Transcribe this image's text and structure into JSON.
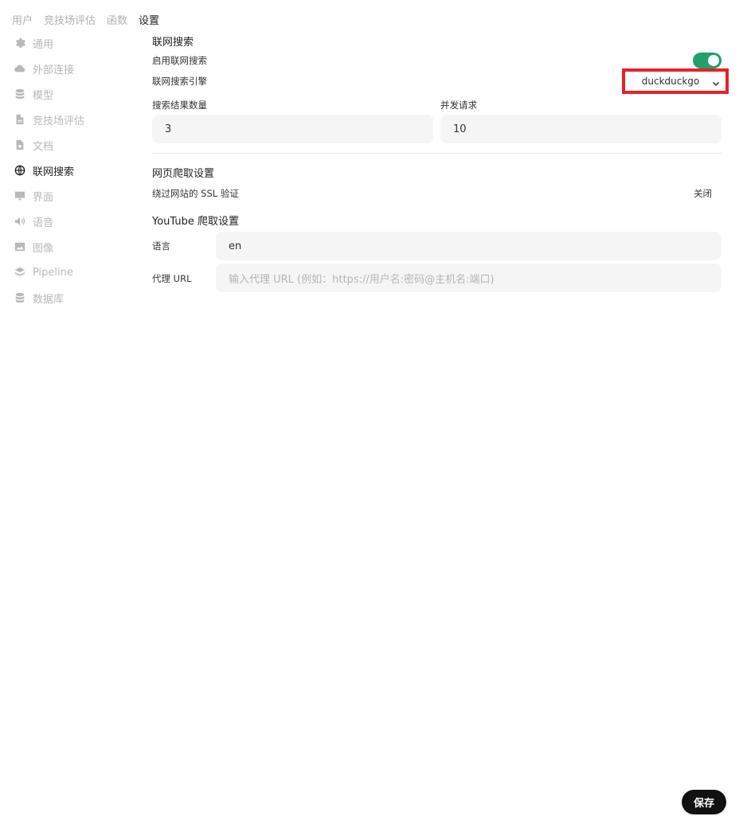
{
  "top_tabs": [
    {
      "label": "用户"
    },
    {
      "label": "竞技场评估"
    },
    {
      "label": "函数"
    },
    {
      "label": "设置"
    }
  ],
  "sidebar": {
    "items": [
      {
        "label": "通用",
        "icon": "gear-icon"
      },
      {
        "label": "外部连接",
        "icon": "cloud-icon"
      },
      {
        "label": "模型",
        "icon": "database-icon"
      },
      {
        "label": "竞技场评估",
        "icon": "document-icon"
      },
      {
        "label": "文档",
        "icon": "document-search-icon"
      },
      {
        "label": "联网搜索",
        "icon": "globe-icon"
      },
      {
        "label": "界面",
        "icon": "monitor-icon"
      },
      {
        "label": "语音",
        "icon": "speaker-icon"
      },
      {
        "label": "图像",
        "icon": "image-icon"
      },
      {
        "label": "Pipeline",
        "icon": "layers-icon"
      },
      {
        "label": "数据库",
        "icon": "database-icon"
      }
    ],
    "active_index": 5
  },
  "web_search": {
    "title": "联网搜索",
    "enable_label": "启用联网搜索",
    "enabled": true,
    "engine_label": "联网搜索引擎",
    "engine_value": "duckduckgo",
    "result_count_label": "搜索结果数量",
    "result_count_value": "3",
    "concurrent_label": "并发请求",
    "concurrent_value": "10"
  },
  "crawl": {
    "title": "网页爬取设置",
    "ssl_label": "绕过网站的 SSL 验证",
    "ssl_status": "关闭"
  },
  "youtube": {
    "title": "YouTube 爬取设置",
    "language_label": "语言",
    "language_value": "en",
    "proxy_label": "代理 URL",
    "proxy_placeholder": "输入代理 URL (例如：https://用户名:密码@主机名:端口)"
  },
  "footer": {
    "save_label": "保存"
  },
  "colors": {
    "toggle_on": "#22a06b",
    "highlight_border": "#e8202a",
    "save_button": "#111111"
  }
}
